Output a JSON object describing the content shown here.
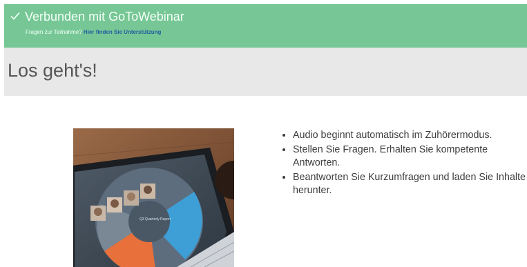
{
  "banner": {
    "title": "Verbunden mit GoToWebinar",
    "help_text": "Fragen zur Teilnahme?",
    "help_link": "Hier finden Sie Unterstützung"
  },
  "page": {
    "title": "Los geht's!"
  },
  "photo": {
    "screen_label": "Q3 Quarterly Report"
  },
  "features": [
    "Audio beginnt automatisch im Zuhörermodus.",
    "Stellen Sie Fragen. Erhalten Sie kompetente Antworten.",
    "Beantworten Sie Kurzumfragen und laden Sie Inhalte herunter."
  ],
  "colors": {
    "banner": "#76c795",
    "link": "#1f5fa0",
    "heading_band": "#e8e8e8"
  }
}
